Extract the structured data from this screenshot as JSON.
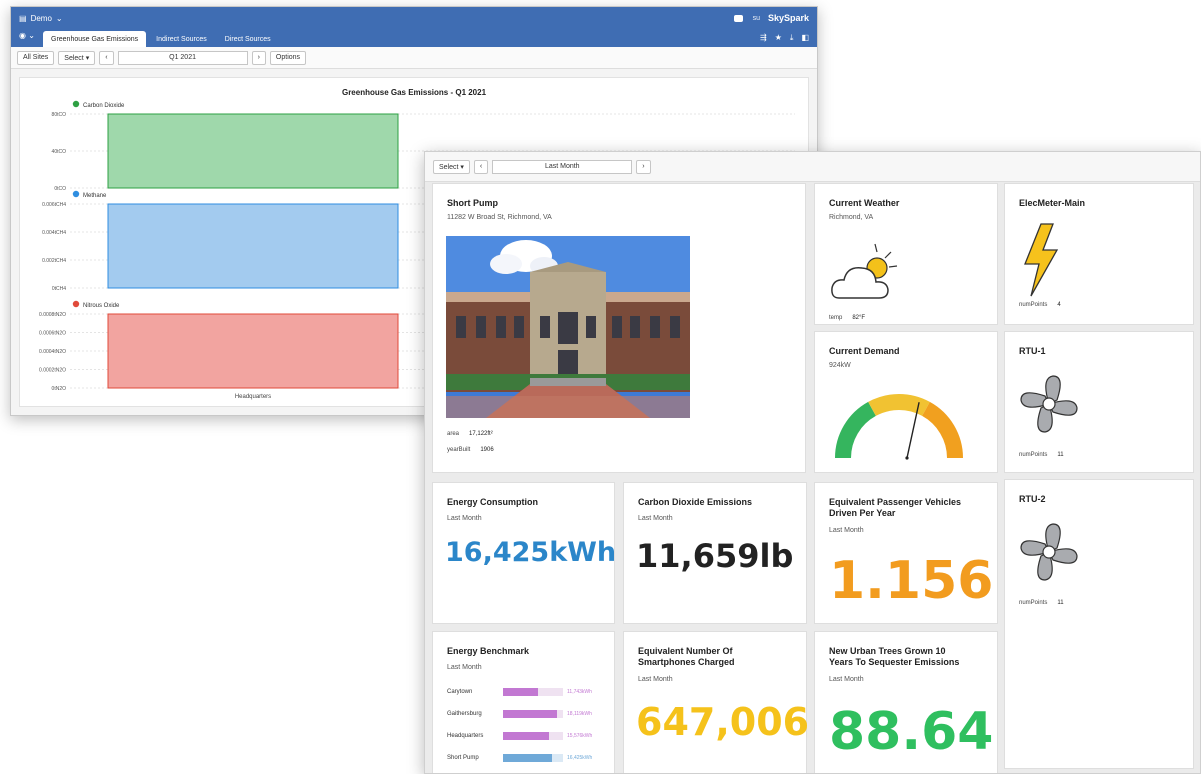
{
  "back": {
    "app_menu": "Demo",
    "user": "su",
    "brand": "SkySpark",
    "tabs": [
      {
        "label": "Greenhouse Gas Emissions"
      },
      {
        "label": "Indirect Sources"
      },
      {
        "label": "Direct Sources"
      }
    ],
    "toolbar": {
      "all_sites": "All Sites",
      "select": "Select ▾",
      "date": "Q1 2021",
      "options": "Options"
    }
  },
  "chart_data": {
    "type": "bar",
    "title": "Greenhouse Gas Emissions - Q1 2021",
    "categories": [
      "Headquarters"
    ],
    "xlabel": "Headquarters",
    "panels": [
      {
        "name": "Carbon Dioxide",
        "color": "#2ea043",
        "fill": "#9fd8ab",
        "ticks": [
          "80tCO",
          "40tCO",
          "0tCO"
        ]
      },
      {
        "name": "Methane",
        "color": "#2f8ee0",
        "fill": "#a3cbef",
        "ticks": [
          "0.006tCH4",
          "0.004tCH4",
          "0.002tCH4",
          "0tCH4"
        ]
      },
      {
        "name": "Nitrous Oxide",
        "color": "#e04a3a",
        "fill": "#f2a4a0",
        "ticks": [
          "0.0008tN2O",
          "0.0006tN2O",
          "0.0004tN2O",
          "0.0002tN2O",
          "0tN2O"
        ]
      }
    ]
  },
  "front": {
    "toolbar": {
      "select": "Select ▾",
      "date": "Last Month"
    },
    "short_pump": {
      "title": "Short Pump",
      "address": "11282 W Broad St, Richmond, VA",
      "area_label": "area",
      "area_value": "17,122ft²",
      "yearbuilt_label": "yearBuilt",
      "yearbuilt_value": "1906"
    },
    "weather": {
      "title": "Current Weather",
      "location": "Richmond, VA",
      "temp_label": "temp",
      "temp_value": "82°F"
    },
    "demand": {
      "title": "Current Demand",
      "value": "924kW",
      "gauge_level": 0.62
    },
    "elecmeter": {
      "title": "ElecMeter-Main",
      "label": "numPoints",
      "value": "4"
    },
    "rtu1": {
      "title": "RTU-1",
      "label": "numPoints",
      "value": "11"
    },
    "rtu2": {
      "title": "RTU-2",
      "label": "numPoints",
      "value": "11"
    },
    "energy": {
      "title": "Energy Consumption",
      "sub": "Last Month",
      "value": "16,425kWh",
      "color": "#2b86c9"
    },
    "co2": {
      "title": "Carbon Dioxide Emissions",
      "sub": "Last Month",
      "value": "11,659lb",
      "color": "#222222"
    },
    "vehicles": {
      "title1": "Equivalent Passenger Vehicles",
      "title2": "Driven Per Year",
      "sub": "Last Month",
      "value": "1.156",
      "color": "#f29c1f"
    },
    "benchmark": {
      "title": "Energy Benchmark",
      "sub": "Last Month",
      "rows": [
        {
          "label": "Carytown",
          "value": "11,743kWh",
          "level": 0.58,
          "color": "#c278d2"
        },
        {
          "label": "Gaithersburg",
          "value": "18,119kWh",
          "level": 0.9,
          "color": "#c278d2"
        },
        {
          "label": "Headquarters",
          "value": "15,576kWh",
          "level": 0.77,
          "color": "#c278d2"
        },
        {
          "label": "Short Pump",
          "value": "16,425kWh",
          "level": 0.81,
          "color": "#6fa9d8"
        }
      ]
    },
    "smartphones": {
      "title1": "Equivalent Number Of",
      "title2": "Smartphones Charged",
      "sub": "Last Month",
      "value": "647,006",
      "color": "#f5c21b"
    },
    "trees": {
      "title1": "New Urban Trees Grown 10",
      "title2": "Years To Sequester Emissions",
      "sub": "Last Month",
      "value": "88.64",
      "color": "#2fbf5f"
    }
  }
}
